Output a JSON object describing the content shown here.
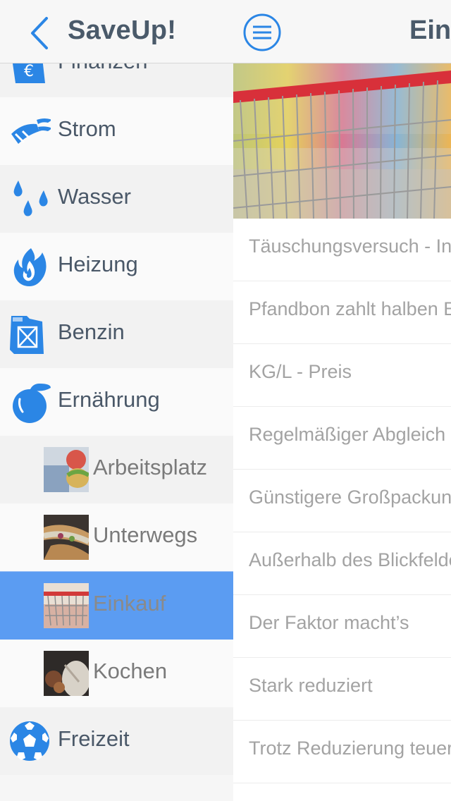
{
  "sidebar": {
    "title": "SaveUp!",
    "items": [
      {
        "label": "Finanzen",
        "icon": "money-bag-icon"
      },
      {
        "label": "Strom",
        "icon": "plug-icon"
      },
      {
        "label": "Wasser",
        "icon": "water-drops-icon"
      },
      {
        "label": "Heizung",
        "icon": "flame-icon"
      },
      {
        "label": "Benzin",
        "icon": "fuel-can-icon"
      },
      {
        "label": "Ernährung",
        "icon": "apple-icon"
      }
    ],
    "sub_items": [
      {
        "label": "Arbeitsplatz",
        "icon": "workplace-food-thumbnail"
      },
      {
        "label": "Unterwegs",
        "icon": "sandwich-thumbnail"
      },
      {
        "label": "Einkauf",
        "icon": "shopping-cart-thumbnail",
        "selected": true
      },
      {
        "label": "Kochen",
        "icon": "cooking-thumbnail"
      }
    ],
    "last_item": {
      "label": "Freizeit",
      "icon": "football-icon"
    }
  },
  "main": {
    "title": "Ein",
    "tips": [
      "Täuschungsversuch - In",
      "Pfandbon zahlt halben E",
      "KG/L - Preis",
      "Regelmäßiger Abgleich",
      "Günstigere Großpackun",
      "Außerhalb des Blickfelde",
      "Der Faktor macht’s",
      "Stark reduziert",
      "Trotz Reduzierung teuer"
    ]
  },
  "colors": {
    "accent": "#2b86e5",
    "selected_row": "#5b9cf2",
    "title_text": "#4a5a6a",
    "tip_text": "#a3a3a3"
  }
}
